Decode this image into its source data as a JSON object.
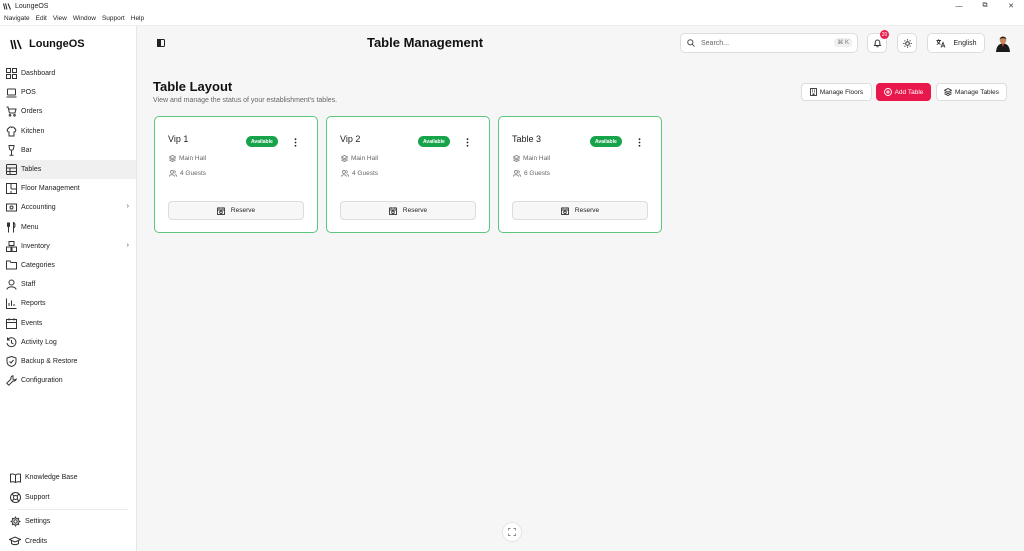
{
  "window": {
    "title": "LoungeOS",
    "minimize": "—",
    "maximize": "⧉",
    "close": "✕"
  },
  "menubar": [
    "Navigate",
    "Edit",
    "View",
    "Window",
    "Support",
    "Help"
  ],
  "brand": {
    "name": "LoungeOS"
  },
  "sidebar": {
    "items": [
      {
        "label": "Dashboard",
        "icon": "dashboard-icon"
      },
      {
        "label": "POS",
        "icon": "laptop-icon"
      },
      {
        "label": "Orders",
        "icon": "cart-icon"
      },
      {
        "label": "Kitchen",
        "icon": "chef-hat-icon"
      },
      {
        "label": "Bar",
        "icon": "wine-icon"
      },
      {
        "label": "Tables",
        "icon": "table-icon",
        "active": true
      },
      {
        "label": "Floor Management",
        "icon": "floor-icon"
      },
      {
        "label": "Accounting",
        "icon": "money-icon",
        "expandable": true
      },
      {
        "label": "Menu",
        "icon": "utensils-icon"
      },
      {
        "label": "Inventory",
        "icon": "boxes-icon",
        "expandable": true
      },
      {
        "label": "Categories",
        "icon": "folder-icon"
      },
      {
        "label": "Staff",
        "icon": "user-icon"
      },
      {
        "label": "Reports",
        "icon": "chart-icon"
      },
      {
        "label": "Events",
        "icon": "calendar-icon"
      },
      {
        "label": "Activity Log",
        "icon": "history-icon"
      },
      {
        "label": "Backup & Restore",
        "icon": "shield-icon"
      },
      {
        "label": "Configuration",
        "icon": "wrench-icon"
      }
    ],
    "bottom": [
      {
        "label": "Knowledge Base",
        "icon": "book-icon"
      },
      {
        "label": "Support",
        "icon": "lifebuoy-icon"
      },
      {
        "label": "Settings",
        "icon": "gear-icon"
      },
      {
        "label": "Credits",
        "icon": "graduation-icon"
      }
    ]
  },
  "header": {
    "title": "Table Management",
    "search_placeholder": "Search...",
    "search_shortcut": "⌘ K",
    "notification_count": "20",
    "language": "English"
  },
  "main": {
    "title": "Table Layout",
    "subtitle": "View and manage the status of your establishment's tables.",
    "buttons": {
      "manage_floors": "Manage Floors",
      "add_table": "Add Table",
      "manage_tables": "Manage Tables"
    },
    "accent_color": "#e8174c",
    "status_color": "#16a34a",
    "tables": [
      {
        "name": "Vip 1",
        "status": "Available",
        "floor": "Main Hall",
        "guests": "4 Guests",
        "reserve": "Reserve"
      },
      {
        "name": "Vip 2",
        "status": "Available",
        "floor": "Main Hall",
        "guests": "4 Guests",
        "reserve": "Reserve"
      },
      {
        "name": "Table 3",
        "status": "Available",
        "floor": "Main Hall",
        "guests": "6 Guests",
        "reserve": "Reserve"
      }
    ]
  }
}
